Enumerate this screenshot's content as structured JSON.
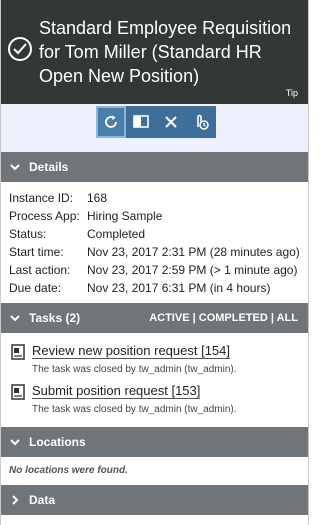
{
  "header": {
    "title": "Standard Employee Requisition for Tom Miller (Standard HR Open New Position)",
    "tip": "Tip"
  },
  "toolbar": {
    "icons": [
      "refresh-icon",
      "flag-icon",
      "close-icon",
      "touch-icon"
    ]
  },
  "details": {
    "section_label": "Details",
    "rows": [
      {
        "label": "Instance ID:",
        "value": "168"
      },
      {
        "label": "Process App:",
        "value": "Hiring Sample"
      },
      {
        "label": "Status:",
        "value": "Completed"
      },
      {
        "label": "Start time:",
        "value": "Nov 23, 2017 2:31 PM (28 minutes ago)"
      },
      {
        "label": "Last action:",
        "value": "Nov 23, 2017 2:59 PM (> 1 minute ago)"
      },
      {
        "label": "Due date:",
        "value": "Nov 23, 2017 6:31 PM (in 4 hours)"
      }
    ]
  },
  "tasks": {
    "section_label": "Tasks (2)",
    "filters": {
      "active": "ACTIVE",
      "sep1": " | ",
      "completed": "COMPLETED",
      "sep2": " | ",
      "all": "ALL"
    },
    "items": [
      {
        "title": "Review new position request [154]",
        "subtitle": "The task was closed by tw_admin (tw_admin)."
      },
      {
        "title": "Submit position request [153]",
        "subtitle": "The task was closed by tw_admin (tw_admin)."
      }
    ]
  },
  "locations": {
    "section_label": "Locations",
    "empty_text": "No locations were found."
  },
  "data": {
    "section_label": "Data"
  },
  "colors": {
    "header_bg": "#333738",
    "section_bg": "#6f7578",
    "toolbar_bg": "#3e6f98",
    "toolbar_area_bg": "#eef0fb"
  }
}
